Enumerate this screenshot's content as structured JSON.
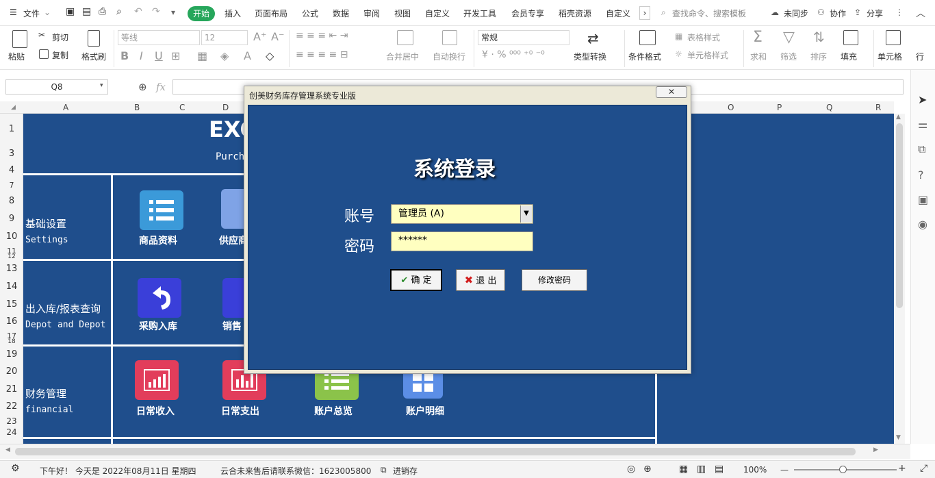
{
  "menubar": {
    "file": "文件",
    "tabs": [
      "开始",
      "插入",
      "页面布局",
      "公式",
      "数据",
      "审阅",
      "视图",
      "自定义",
      "开发工具",
      "会员专享",
      "稻壳资源",
      "自定义"
    ],
    "search_placeholder": "查找命令、搜索模板",
    "sync": "未同步",
    "collab": "协作",
    "share": "分享"
  },
  "ribbon": {
    "paste": "粘贴",
    "cut": "剪切",
    "copy": "复制",
    "format_painter": "格式刷",
    "font_name": "等线",
    "font_size": "12",
    "merge_center": "合并居中",
    "wrap": "自动换行",
    "number_format": "常规",
    "type_convert": "类型转换",
    "cond_format": "条件格式",
    "table_style": "表格样式",
    "cell_style": "单元格样式",
    "sum": "求和",
    "filter": "筛选",
    "sort": "排序",
    "fill": "填充",
    "cell": "单元格",
    "row": "行"
  },
  "formulabar": {
    "cell_ref": "Q8",
    "fx": "fx"
  },
  "grid": {
    "columns": [
      "A",
      "B",
      "C",
      "D",
      "O",
      "P",
      "Q",
      "R"
    ],
    "rows": [
      "1",
      "3",
      "4",
      "7",
      "8",
      "9",
      "10",
      "11",
      "12",
      "13",
      "14",
      "15",
      "16",
      "17",
      "18",
      "19",
      "20",
      "21",
      "22",
      "23",
      "24"
    ]
  },
  "sheet": {
    "title_partial": "EXC",
    "subtitle_partial": "Purch",
    "sections": [
      {
        "cn": "基础设置",
        "en": "Settings"
      },
      {
        "cn": "出入库/报表查询",
        "en": "Depot and Depot"
      },
      {
        "cn": "财务管理",
        "en": "financial"
      }
    ],
    "tiles": {
      "goods": "商品资料",
      "supplier": "供应商",
      "purchase_in": "采购入库",
      "sales": "销售",
      "daily_income": "日常收入",
      "daily_expense": "日常支出",
      "account_overview": "账户总览",
      "account_detail": "账户明细"
    }
  },
  "dialog": {
    "title": "创美财务库存管理系统专业版",
    "close": "✕",
    "heading": "系统登录",
    "account_label": "账号",
    "account_value": "管理员 (A)",
    "password_label": "密码",
    "password_value": "******",
    "ok": "确 定",
    "exit": "退 出",
    "change_pwd": "修改密码"
  },
  "statusbar": {
    "greeting": "下午好！ 今天是 2022年08月11日 星期四",
    "contact": "云合未来售后请联系微信：1623005800",
    "sheet_tab": "进销存",
    "zoom": "100%"
  },
  "colors": {
    "sheet_blue": "#1f4e8c",
    "accent_green": "#26a65b",
    "input_yellow": "#ffffc0"
  }
}
